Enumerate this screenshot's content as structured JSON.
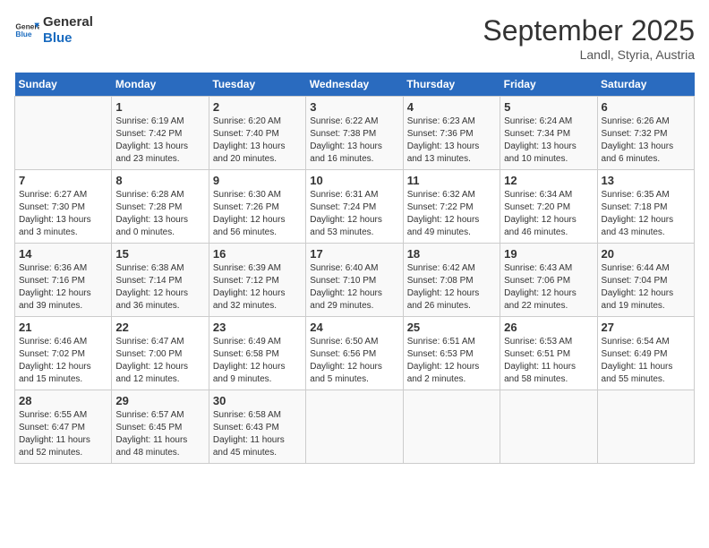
{
  "header": {
    "logo_general": "General",
    "logo_blue": "Blue",
    "month_title": "September 2025",
    "location": "Landl, Styria, Austria"
  },
  "days_of_week": [
    "Sunday",
    "Monday",
    "Tuesday",
    "Wednesday",
    "Thursday",
    "Friday",
    "Saturday"
  ],
  "weeks": [
    [
      {
        "day": "",
        "info": ""
      },
      {
        "day": "1",
        "info": "Sunrise: 6:19 AM\nSunset: 7:42 PM\nDaylight: 13 hours\nand 23 minutes."
      },
      {
        "day": "2",
        "info": "Sunrise: 6:20 AM\nSunset: 7:40 PM\nDaylight: 13 hours\nand 20 minutes."
      },
      {
        "day": "3",
        "info": "Sunrise: 6:22 AM\nSunset: 7:38 PM\nDaylight: 13 hours\nand 16 minutes."
      },
      {
        "day": "4",
        "info": "Sunrise: 6:23 AM\nSunset: 7:36 PM\nDaylight: 13 hours\nand 13 minutes."
      },
      {
        "day": "5",
        "info": "Sunrise: 6:24 AM\nSunset: 7:34 PM\nDaylight: 13 hours\nand 10 minutes."
      },
      {
        "day": "6",
        "info": "Sunrise: 6:26 AM\nSunset: 7:32 PM\nDaylight: 13 hours\nand 6 minutes."
      }
    ],
    [
      {
        "day": "7",
        "info": "Sunrise: 6:27 AM\nSunset: 7:30 PM\nDaylight: 13 hours\nand 3 minutes."
      },
      {
        "day": "8",
        "info": "Sunrise: 6:28 AM\nSunset: 7:28 PM\nDaylight: 13 hours\nand 0 minutes."
      },
      {
        "day": "9",
        "info": "Sunrise: 6:30 AM\nSunset: 7:26 PM\nDaylight: 12 hours\nand 56 minutes."
      },
      {
        "day": "10",
        "info": "Sunrise: 6:31 AM\nSunset: 7:24 PM\nDaylight: 12 hours\nand 53 minutes."
      },
      {
        "day": "11",
        "info": "Sunrise: 6:32 AM\nSunset: 7:22 PM\nDaylight: 12 hours\nand 49 minutes."
      },
      {
        "day": "12",
        "info": "Sunrise: 6:34 AM\nSunset: 7:20 PM\nDaylight: 12 hours\nand 46 minutes."
      },
      {
        "day": "13",
        "info": "Sunrise: 6:35 AM\nSunset: 7:18 PM\nDaylight: 12 hours\nand 43 minutes."
      }
    ],
    [
      {
        "day": "14",
        "info": "Sunrise: 6:36 AM\nSunset: 7:16 PM\nDaylight: 12 hours\nand 39 minutes."
      },
      {
        "day": "15",
        "info": "Sunrise: 6:38 AM\nSunset: 7:14 PM\nDaylight: 12 hours\nand 36 minutes."
      },
      {
        "day": "16",
        "info": "Sunrise: 6:39 AM\nSunset: 7:12 PM\nDaylight: 12 hours\nand 32 minutes."
      },
      {
        "day": "17",
        "info": "Sunrise: 6:40 AM\nSunset: 7:10 PM\nDaylight: 12 hours\nand 29 minutes."
      },
      {
        "day": "18",
        "info": "Sunrise: 6:42 AM\nSunset: 7:08 PM\nDaylight: 12 hours\nand 26 minutes."
      },
      {
        "day": "19",
        "info": "Sunrise: 6:43 AM\nSunset: 7:06 PM\nDaylight: 12 hours\nand 22 minutes."
      },
      {
        "day": "20",
        "info": "Sunrise: 6:44 AM\nSunset: 7:04 PM\nDaylight: 12 hours\nand 19 minutes."
      }
    ],
    [
      {
        "day": "21",
        "info": "Sunrise: 6:46 AM\nSunset: 7:02 PM\nDaylight: 12 hours\nand 15 minutes."
      },
      {
        "day": "22",
        "info": "Sunrise: 6:47 AM\nSunset: 7:00 PM\nDaylight: 12 hours\nand 12 minutes."
      },
      {
        "day": "23",
        "info": "Sunrise: 6:49 AM\nSunset: 6:58 PM\nDaylight: 12 hours\nand 9 minutes."
      },
      {
        "day": "24",
        "info": "Sunrise: 6:50 AM\nSunset: 6:56 PM\nDaylight: 12 hours\nand 5 minutes."
      },
      {
        "day": "25",
        "info": "Sunrise: 6:51 AM\nSunset: 6:53 PM\nDaylight: 12 hours\nand 2 minutes."
      },
      {
        "day": "26",
        "info": "Sunrise: 6:53 AM\nSunset: 6:51 PM\nDaylight: 11 hours\nand 58 minutes."
      },
      {
        "day": "27",
        "info": "Sunrise: 6:54 AM\nSunset: 6:49 PM\nDaylight: 11 hours\nand 55 minutes."
      }
    ],
    [
      {
        "day": "28",
        "info": "Sunrise: 6:55 AM\nSunset: 6:47 PM\nDaylight: 11 hours\nand 52 minutes."
      },
      {
        "day": "29",
        "info": "Sunrise: 6:57 AM\nSunset: 6:45 PM\nDaylight: 11 hours\nand 48 minutes."
      },
      {
        "day": "30",
        "info": "Sunrise: 6:58 AM\nSunset: 6:43 PM\nDaylight: 11 hours\nand 45 minutes."
      },
      {
        "day": "",
        "info": ""
      },
      {
        "day": "",
        "info": ""
      },
      {
        "day": "",
        "info": ""
      },
      {
        "day": "",
        "info": ""
      }
    ]
  ]
}
